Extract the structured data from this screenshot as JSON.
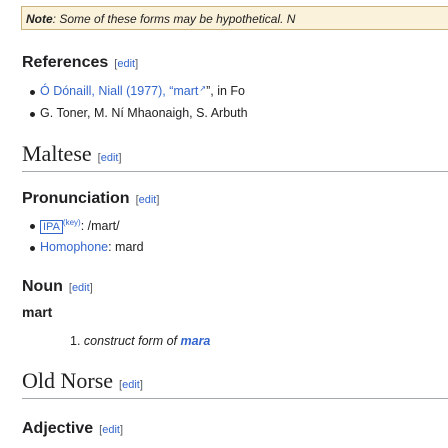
{
  "note": {
    "prefix": "Note",
    "text": ": Some of these forms may be hypothetical. N"
  },
  "references": {
    "heading": "References",
    "edit": "edit",
    "items": [
      {
        "text": "Ó Dónaill, Niall (1977), “mart",
        "link_tail": "”, in Fo"
      },
      {
        "text": "G. Toner, M. Ní Mhaonaigh, S. Arbuth"
      }
    ]
  },
  "maltese": {
    "heading": "Maltese",
    "edit": "edit"
  },
  "pronunciation": {
    "heading": "Pronunciation",
    "edit": "edit",
    "ipa_label": "IPA",
    "ipa_key": "(key)",
    "ipa_value": ": /mart/",
    "homophone_label": "Homophone",
    "homophone_value": ": mard"
  },
  "noun": {
    "heading": "Noun",
    "edit": "edit",
    "headword": "mart",
    "definition_num": "1.",
    "definition_pre": "construct form of",
    "definition_link": "mara"
  },
  "old_norse": {
    "heading": "Old Norse",
    "edit": "edit"
  },
  "adjective": {
    "heading": "Adjective",
    "edit": "edit"
  }
}
